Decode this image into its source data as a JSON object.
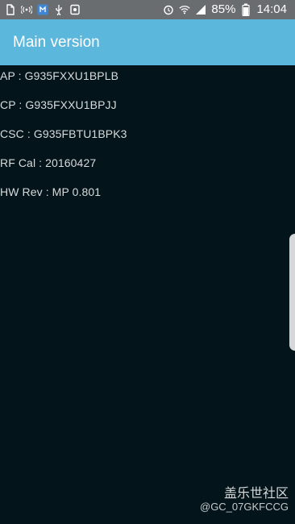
{
  "status_bar": {
    "battery_percent": "85%",
    "time": "14:04",
    "left_icons": [
      "file-icon",
      "signal-broadcast-icon",
      "data-icon",
      "usb-icon",
      "gallery-icon"
    ],
    "right_icons": [
      "alarm-icon",
      "wifi-icon",
      "cell-signal-icon",
      "battery-icon"
    ]
  },
  "app_bar": {
    "title": "Main version",
    "color": "#5bb7dc"
  },
  "version_info": [
    {
      "text": "AP : G935FXXU1BPLB"
    },
    {
      "text": "CP :  G935FXXU1BPJJ"
    },
    {
      "text": "CSC :  G935FBTU1BPK3"
    },
    {
      "text": "RF Cal : 20160427"
    },
    {
      "text": "HW Rev : MP 0.801"
    }
  ],
  "watermark": {
    "site": "盖乐世社区",
    "user": "@GC_07GKFCCG"
  }
}
